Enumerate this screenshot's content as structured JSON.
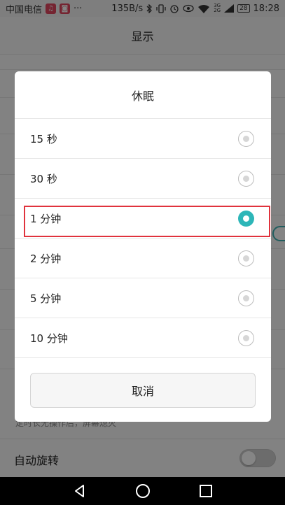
{
  "status_bar": {
    "carrier": "中国电信",
    "app_icons": [
      "music-icon",
      "app-icon"
    ],
    "more": "···",
    "net_speed": "135B/s",
    "signal_tag_top": "3G",
    "signal_tag_bottom": "2G",
    "battery": "28",
    "time": "18:28"
  },
  "page": {
    "title": "显示",
    "sleep_desc": "定时长无操作后，屏幕熄灭",
    "auto_rotate_label": "自动旋转"
  },
  "dialog": {
    "title": "休眠",
    "options": [
      {
        "label": "15 秒",
        "selected": false
      },
      {
        "label": "30 秒",
        "selected": false
      },
      {
        "label": "1 分钟",
        "selected": true
      },
      {
        "label": "2 分钟",
        "selected": false
      },
      {
        "label": "5 分钟",
        "selected": false
      },
      {
        "label": "10 分钟",
        "selected": false
      }
    ],
    "cancel_label": "取消"
  },
  "colors": {
    "accent": "#2db6b8",
    "highlight_border": "#e0333d"
  }
}
